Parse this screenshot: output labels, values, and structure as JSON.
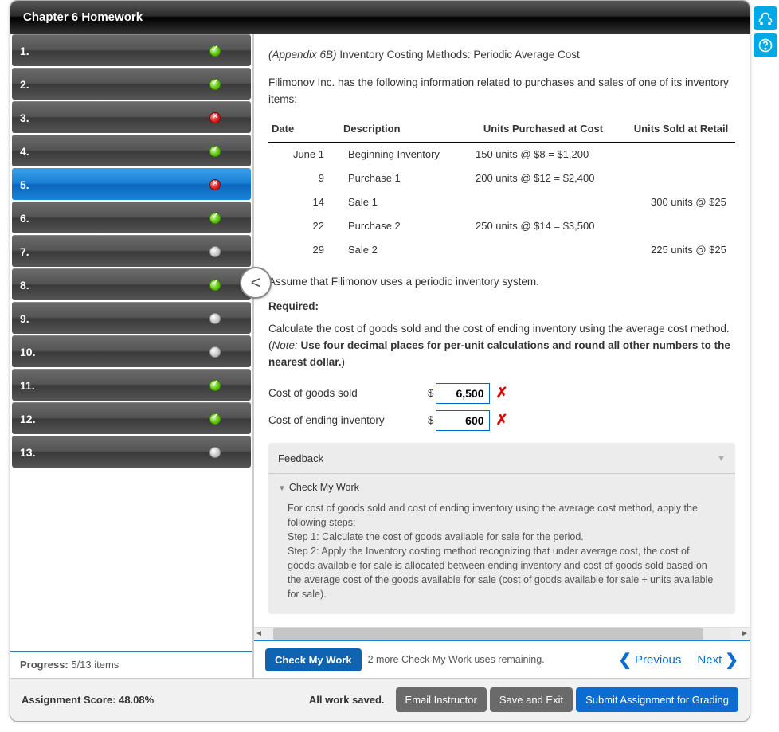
{
  "header": {
    "title": "Chapter 6 Homework"
  },
  "sidebar": {
    "items": [
      {
        "num": "1.",
        "status": "correct"
      },
      {
        "num": "2.",
        "status": "correct"
      },
      {
        "num": "3.",
        "status": "wrong"
      },
      {
        "num": "4.",
        "status": "correct"
      },
      {
        "num": "5.",
        "status": "wrong",
        "active": true
      },
      {
        "num": "6.",
        "status": "correct"
      },
      {
        "num": "7.",
        "status": "blank"
      },
      {
        "num": "8.",
        "status": "correct"
      },
      {
        "num": "9.",
        "status": "blank"
      },
      {
        "num": "10.",
        "status": "blank"
      },
      {
        "num": "11.",
        "status": "correct"
      },
      {
        "num": "12.",
        "status": "correct"
      },
      {
        "num": "13.",
        "status": "blank"
      }
    ],
    "progress_label": "Progress:",
    "progress_value": "5/13 items"
  },
  "collapse_glyph": "<",
  "question": {
    "prefix_italic": "(Appendix 6B)",
    "title_rest": " Inventory Costing Methods: Periodic Average Cost",
    "intro": "Filimonov Inc. has the following information related to purchases and sales of one of its inventory items:",
    "table_headers": {
      "date": "Date",
      "desc": "Description",
      "purch": "Units Purchased at Cost",
      "sold": "Units Sold at Retail"
    },
    "rows": [
      {
        "date": "June 1",
        "desc": "Beginning Inventory",
        "purch": "150 units @ $8 = $1,200",
        "sold": ""
      },
      {
        "date": "9",
        "desc": "Purchase 1",
        "purch": "200 units @ $12 = $2,400",
        "sold": ""
      },
      {
        "date": "14",
        "desc": "Sale 1",
        "purch": "",
        "sold": "300 units @ $25"
      },
      {
        "date": "22",
        "desc": "Purchase 2",
        "purch": "250 units @ $14 = $3,500",
        "sold": ""
      },
      {
        "date": "29",
        "desc": "Sale 2",
        "purch": "",
        "sold": "225 units @ $25"
      }
    ],
    "assume": "Assume that Filimonov uses a periodic inventory system.",
    "required_label": "Required:",
    "required_text_a": "Calculate the cost of goods sold and the cost of ending inventory using the average cost method. (",
    "required_note": "Note:",
    "required_text_b": " Use four decimal places for per-unit calculations and round all other numbers to the nearest dollar.",
    "required_text_c": ")",
    "answers": {
      "cogs_label": "Cost of goods sold",
      "cogs_value": "6,500",
      "cogs_mark": "✗",
      "ending_label": "Cost of ending inventory",
      "ending_value": "600",
      "ending_mark": "✗",
      "currency": "$"
    }
  },
  "feedback": {
    "title": "Feedback",
    "subtitle": "Check My Work",
    "body": "For cost of goods sold and cost of ending inventory using the average cost method, apply the following steps:\nStep 1: Calculate the cost of goods available for sale for the period.\nStep 2: Apply the Inventory costing method recognizing that under average cost, the cost of goods available for sale is allocated between ending inventory and cost of goods sold based on the average cost of the goods available for sale (cost of goods available for sale ÷ units available for sale)."
  },
  "actions": {
    "check": "Check My Work",
    "remaining": "2 more Check My Work uses remaining.",
    "prev": "Previous",
    "next": "Next"
  },
  "footer": {
    "score": "Assignment Score: 48.08%",
    "saved": "All work saved.",
    "email": "Email Instructor",
    "save": "Save and Exit",
    "submit": "Submit Assignment for Grading"
  }
}
